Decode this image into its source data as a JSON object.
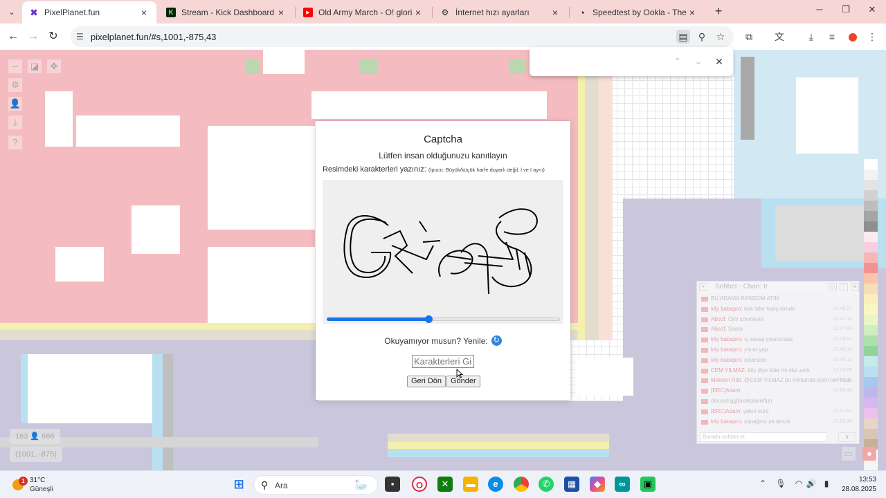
{
  "browser": {
    "tabs": [
      {
        "title": "PixelPlanet.fun",
        "favicon": "pixelplanet-icon",
        "active": true
      },
      {
        "title": "Stream - Kick Dashboard",
        "favicon": "kick-icon",
        "active": false
      },
      {
        "title": "Old Army March - O! glorious a",
        "favicon": "youtube-icon",
        "active": false
      },
      {
        "title": "İnternet hızı ayarları",
        "favicon": "gear-icon",
        "active": false
      },
      {
        "title": "Speedtest by Ookla - The Glob",
        "favicon": "speedtest-icon",
        "active": false
      }
    ],
    "url": "pixelplanet.fun/#s,1001,-875,43"
  },
  "find_bar": {
    "query": ""
  },
  "captcha": {
    "title": "Captcha",
    "subtitle": "Lütfen insan olduğunuzu kanıtlayın",
    "instruction": "Resimdeki karakterleri yazınız:",
    "hint": "(İpucu: Büyük/küçük harfe duyarlı değil; l ve I aynı)",
    "image_text": "GRsqS",
    "slider_fraction": 0.44,
    "reload_text": "Okuyamıyor musun? Yenile:",
    "input_placeholder": "Karakterleri Gir",
    "back_label": "Geri Dön",
    "submit_label": "Gönder"
  },
  "canvas": {
    "coords": "(1001, -875)",
    "counter": "163 👤 666"
  },
  "chat": {
    "title": "Sohbet - Chan: tr",
    "messages": [
      {
        "name": "",
        "text": "BU ADAMA RANDOM ATIN",
        "time": ""
      },
      {
        "name": "kity babapro:",
        "text": "bak lider toplu kimde",
        "time": "13:46:21"
      },
      {
        "name": "Abcdf:",
        "text": "Ölm sövmeyin",
        "time": "13:47:12"
      },
      {
        "name": "Abcdf:",
        "text": "Saatn",
        "time": "13:47:28"
      },
      {
        "name": "kity babapro:",
        "text": "ıç savaş çıkartıcalar",
        "time": "13:48:02"
      },
      {
        "name": "kity babapro:",
        "text": "yıkım yap",
        "time": "13:48:10"
      },
      {
        "name": "kity babapro:",
        "text": "çıkarsam",
        "time": "13:48:31"
      },
      {
        "name": "CEM YILMAZ:",
        "text": "kity diye lider mi olur amk",
        "time": "13:49:05"
      },
      {
        "name": "Maksim Ritz:",
        "text": "@CEM YILMAZ bu mekanda içten her kadar senin şerefine kaldır",
        "time": "13:50:11"
      },
      {
        "name": "[ERC]Adam:",
        "text": "",
        "time": "13:50:40"
      },
      {
        "name": "",
        "text": "discord.gg/pixelplanetfun",
        "time": ""
      },
      {
        "name": "[ERC]Adam:",
        "text": "yakın süre",
        "time": "13:51:02"
      },
      {
        "name": "kity babapro:",
        "text": "yanağımı ye amcık",
        "time": "13:52:48"
      }
    ],
    "input_placeholder": "Burada sohbet et",
    "lang": "tr"
  },
  "taskbar": {
    "weather_temp": "31°C",
    "weather_cond": "Güneşli",
    "weather_badge": "1",
    "search_label": "Ara",
    "time": "13:53",
    "date": "28.08.2025"
  }
}
